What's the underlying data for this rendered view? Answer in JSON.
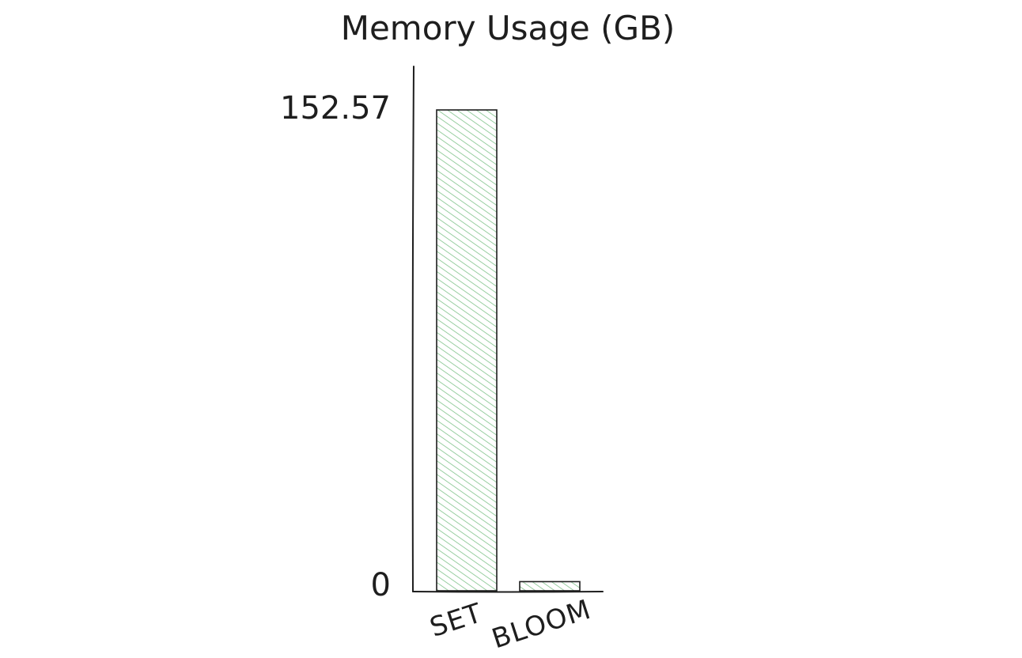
{
  "chart_data": {
    "type": "bar",
    "title": "Memory Usage (GB)",
    "categories": [
      "SET",
      "BLOOM"
    ],
    "values": [
      152.57,
      2.9
    ],
    "ylim": [
      0,
      152.57
    ],
    "y_ticks": [
      "0",
      "152.57"
    ],
    "xlabel": "",
    "ylabel": "",
    "grid": false,
    "legend": "none",
    "bar_fill_color": "#7fc28a",
    "stroke_color": "#1e1e1e"
  }
}
